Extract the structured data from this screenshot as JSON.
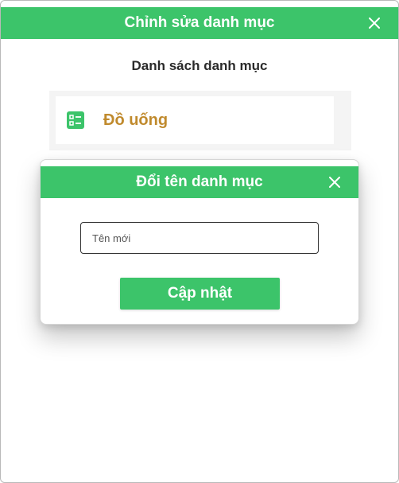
{
  "edit_window": {
    "title": "Chỉnh sửa danh mục",
    "close_icon": "close-icon"
  },
  "category_list": {
    "heading": "Danh sách danh mục",
    "items": [
      {
        "label": "Đồ uống",
        "icon": "list-icon"
      }
    ]
  },
  "rename_dialog": {
    "title": "Đổi tên danh mục",
    "close_icon": "close-icon",
    "input": {
      "placeholder": "Tên mới",
      "value": ""
    },
    "submit_label": "Cập nhật"
  },
  "colors": {
    "accent": "#3cc46a",
    "item_text": "#c08a2d",
    "panel_bg": "#f4f4f4"
  }
}
